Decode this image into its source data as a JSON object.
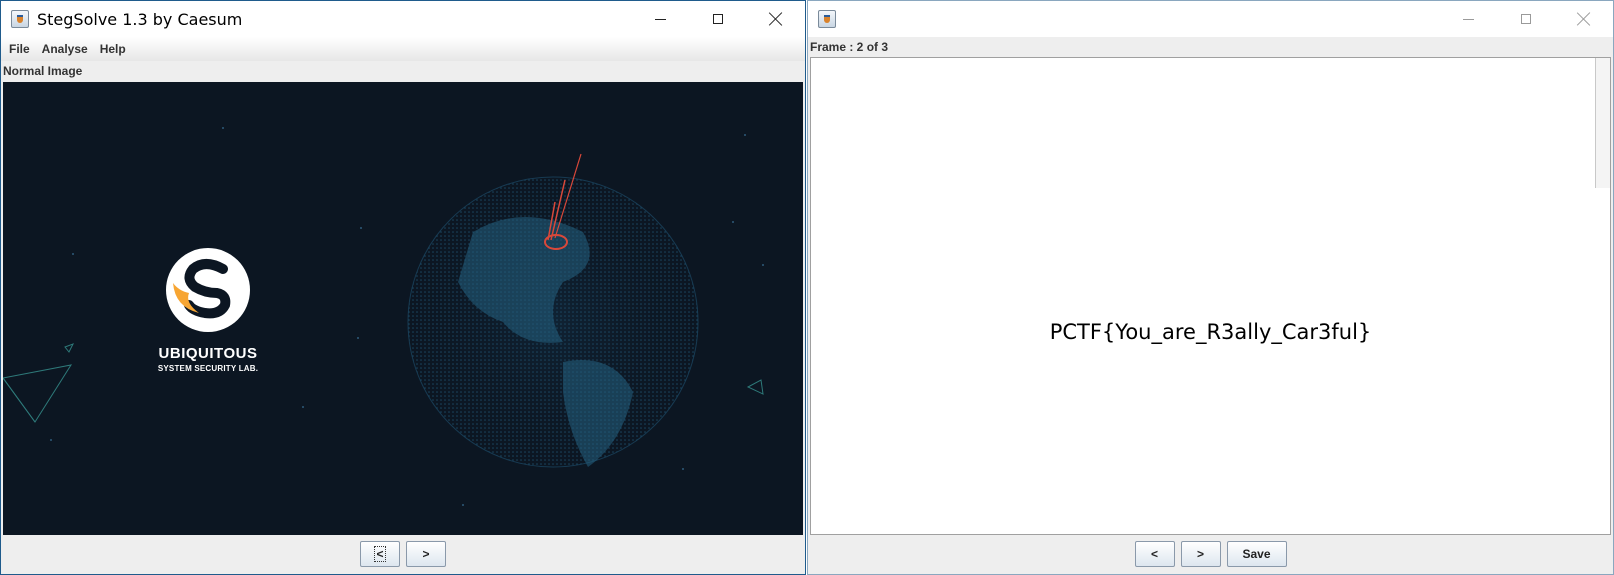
{
  "left_window": {
    "title": "StegSolve 1.3 by Caesum",
    "menu": [
      "File",
      "Analyse",
      "Help"
    ],
    "panel_label": "Normal Image",
    "image": {
      "brand": "UBIQUITOUS",
      "brand_sub": "SYSTEM SECURITY LAB."
    },
    "buttons": {
      "prev": "<",
      "next": ">"
    }
  },
  "right_window": {
    "title": "",
    "frame_label": "Frame : 2 of 3",
    "flag_text": "PCTF{You_are_R3ally_Car3ful}",
    "buttons": {
      "prev": "<",
      "next": ">",
      "save": "Save"
    }
  },
  "colors": {
    "image_background": "#0c1622",
    "logo_orange": "#f7a532",
    "marker_red": "#d9483a",
    "globe_blue": "#1c4a66"
  },
  "icons": [
    "app-icon",
    "minimize-icon",
    "maximize-icon",
    "close-icon"
  ]
}
